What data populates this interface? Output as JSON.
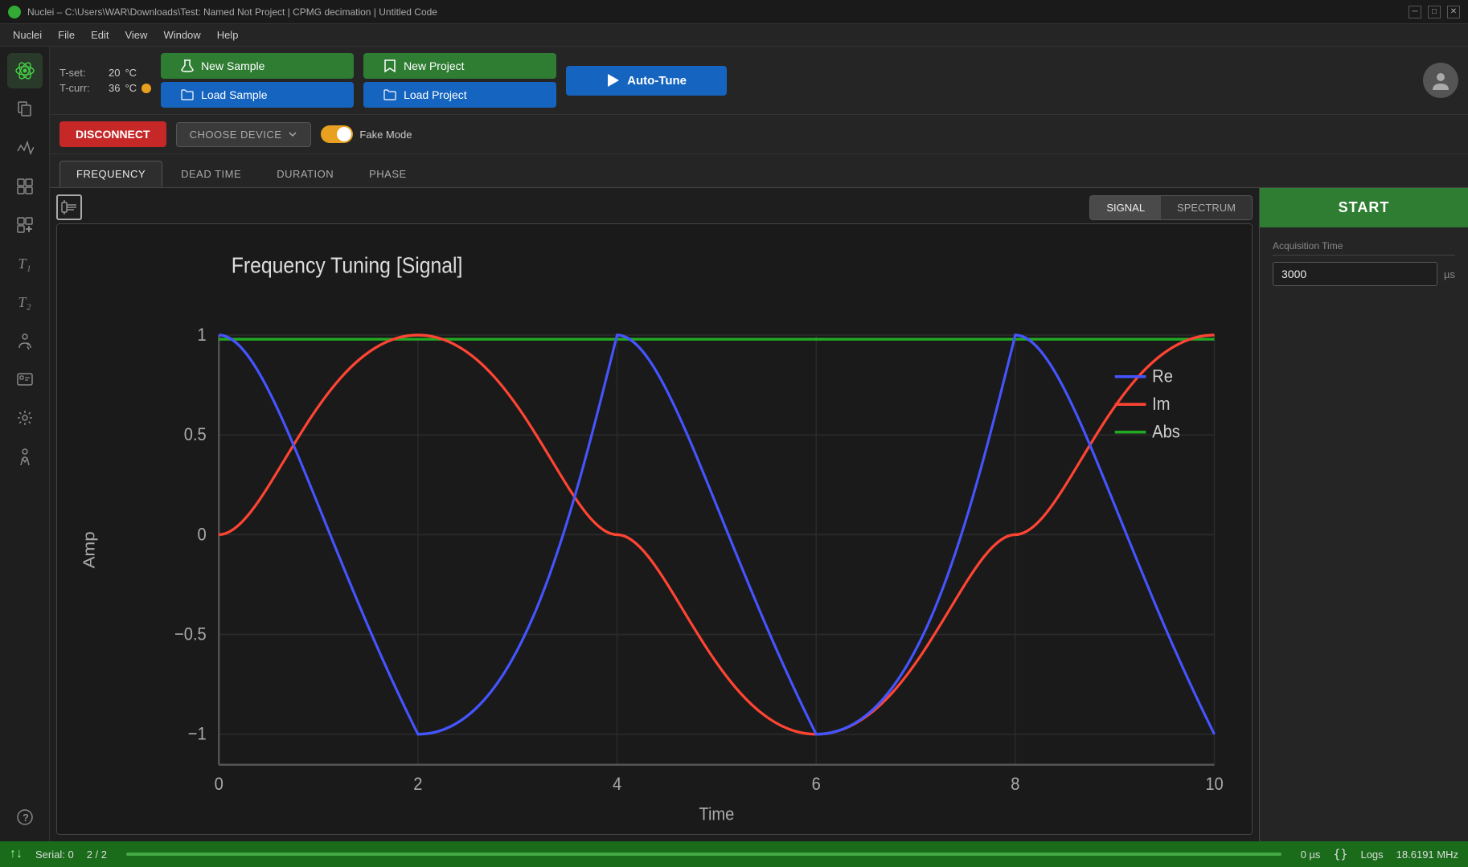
{
  "titlebar": {
    "title": "Nuclei – C:\\Users\\WAR\\Downloads\\Test: Named Not Project | CPMG decimation | Untitled Code",
    "logo": "N"
  },
  "menubar": {
    "items": [
      "Nuclei",
      "File",
      "Edit",
      "View",
      "Window",
      "Help"
    ]
  },
  "toolbar": {
    "tset_label": "T-set:",
    "tset_value": "20",
    "tset_unit": "°C",
    "tcurr_label": "T-curr:",
    "tcurr_value": "36",
    "tcurr_unit": "°C",
    "new_sample_label": "New Sample",
    "load_sample_label": "Load Sample",
    "new_project_label": "New Project",
    "load_project_label": "Load Project",
    "autotune_label": "Auto-Tune"
  },
  "devicebar": {
    "disconnect_label": "DISCONNECT",
    "choose_device_label": "CHOOSE DEVICE",
    "fake_mode_label": "Fake Mode"
  },
  "tabs": {
    "items": [
      "FREQUENCY",
      "DEAD TIME",
      "DURATION",
      "PHASE"
    ],
    "active": 0
  },
  "chart": {
    "title": "Frequency Tuning [Signal]",
    "signal_btn": "SIGNAL",
    "spectrum_btn": "SPECTRUM",
    "y_axis_label": "Amp",
    "x_axis_label": "Time",
    "y_ticks": [
      "1",
      "0.5",
      "0",
      "-0.5",
      "-1"
    ],
    "x_ticks": [
      "0",
      "2",
      "4",
      "6",
      "8",
      "10"
    ],
    "legend": {
      "re_label": "Re",
      "im_label": "Im",
      "abs_label": "Abs",
      "re_color": "#4455ff",
      "im_color": "#ff4433",
      "abs_color": "#22aa22"
    }
  },
  "right_panel": {
    "start_label": "START",
    "acq_time_label": "Acquisition Time",
    "acq_time_value": "3000",
    "acq_time_unit": "µs"
  },
  "statusbar": {
    "serial_label": "Serial: 0",
    "progress_label": "2 / 2",
    "time_label": "0 µs",
    "logs_label": "Logs",
    "freq_label": "18.6191 MHz"
  }
}
